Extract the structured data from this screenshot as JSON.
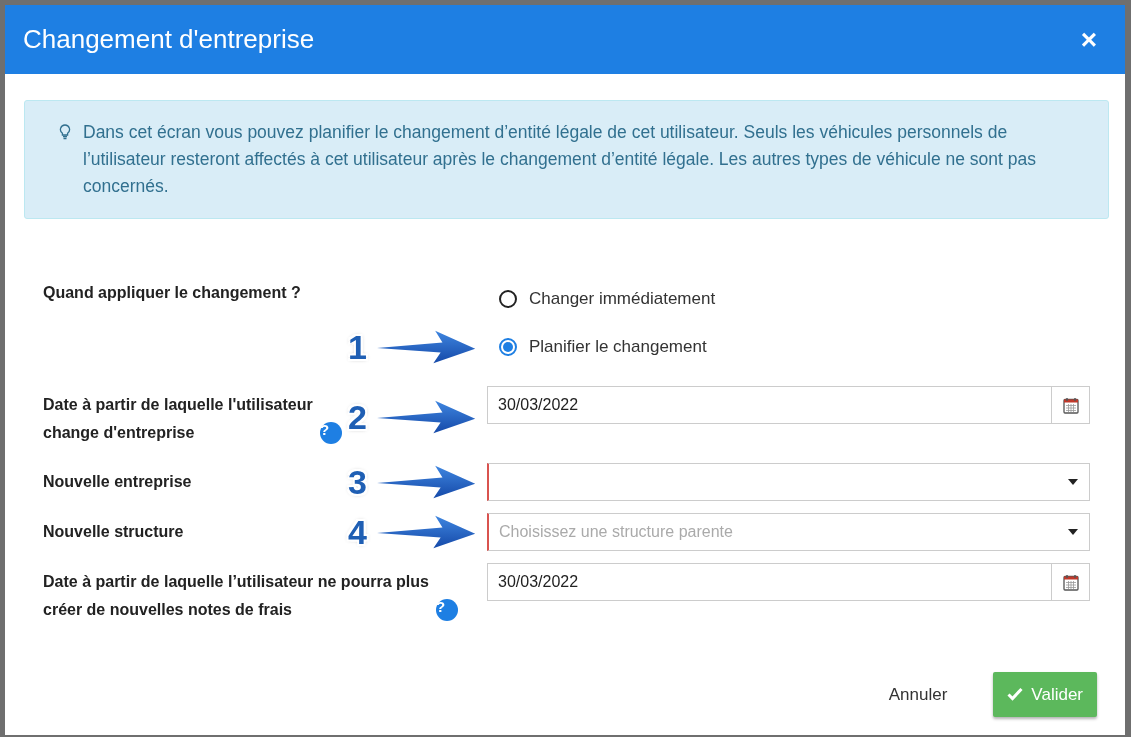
{
  "modal": {
    "title": "Changement d'entreprise",
    "close": "×"
  },
  "info": {
    "text": "Dans cet écran vous pouvez planifier le changement d’entité légale de cet utilisateur. Seuls les véhicules personnels de l’utilisateur resteront affectés à cet utilisateur après le changement d’entité légale. Les autres types de véhicule ne sont pas concernés."
  },
  "when": {
    "label": "Quand appliquer le changement ?",
    "options": [
      {
        "label": "Changer immédiatement",
        "selected": false
      },
      {
        "label": "Planifier le changement",
        "selected": true,
        "callout": "1"
      }
    ]
  },
  "fields": [
    {
      "kind": "date",
      "label": "Date à partir de laquelle l'utilisateur change d'entreprise",
      "help": "?",
      "value": "30/03/2022",
      "callout": "2"
    },
    {
      "kind": "select",
      "label": "Nouvelle entreprise",
      "invalid": true,
      "callout": "3"
    },
    {
      "kind": "select",
      "label": "Nouvelle structure",
      "placeholder": "Choisissez une structure parente",
      "invalid": true,
      "callout": "4"
    },
    {
      "kind": "date",
      "label": "Date à partir de laquelle l’utilisateur ne pourra plus créer de nouvelles notes de frais",
      "help": "?",
      "value": "30/03/2022"
    }
  ],
  "footer": {
    "cancel": "Annuler",
    "submit": "Valider"
  }
}
